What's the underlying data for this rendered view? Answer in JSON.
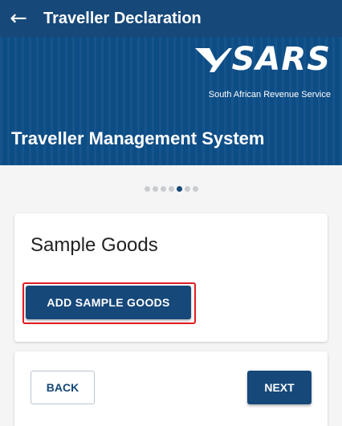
{
  "appbar": {
    "back_icon": "arrow-left-icon",
    "title": "Traveller Declaration"
  },
  "banner": {
    "logo_text": "SARS",
    "logo_subtitle": "South African Revenue Service",
    "title": "Traveller Management System"
  },
  "stepper": {
    "total_steps": 7,
    "active_step": 5
  },
  "sample_goods": {
    "heading": "Sample Goods",
    "add_button_label": "ADD SAMPLE GOODS"
  },
  "navigation": {
    "back_label": "BACK",
    "next_label": "NEXT"
  },
  "colors": {
    "primary": "#16487a",
    "banner": "#0d4d86",
    "highlight": "#e31b23",
    "background": "#f5f5f5"
  }
}
